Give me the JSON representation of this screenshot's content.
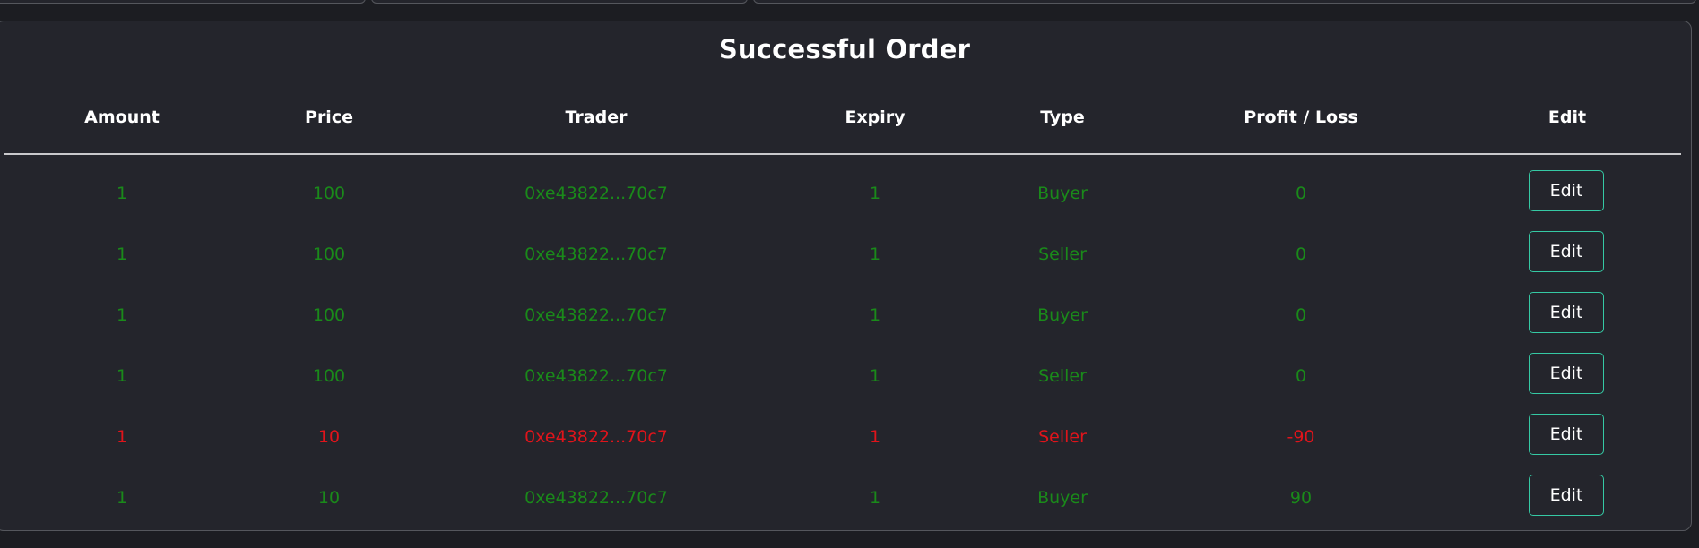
{
  "page": {
    "title": "Successful Order"
  },
  "colors": {
    "profit": "#1a8a1a",
    "loss": "#e0141b",
    "header_text": "#ffffff",
    "edit_border": "#35c9a4"
  },
  "table": {
    "headers": {
      "amount": "Amount",
      "price": "Price",
      "trader": "Trader",
      "expiry": "Expiry",
      "type": "Type",
      "profit_loss": "Profit / Loss",
      "edit": "Edit"
    },
    "rows": [
      {
        "amount": "1",
        "price": "100",
        "trader": "0xe43822...70c7",
        "expiry": "1",
        "type": "Buyer",
        "profit_loss": "0",
        "edit": "Edit",
        "status": "profit"
      },
      {
        "amount": "1",
        "price": "100",
        "trader": "0xe43822...70c7",
        "expiry": "1",
        "type": "Seller",
        "profit_loss": "0",
        "edit": "Edit",
        "status": "profit"
      },
      {
        "amount": "1",
        "price": "100",
        "trader": "0xe43822...70c7",
        "expiry": "1",
        "type": "Buyer",
        "profit_loss": "0",
        "edit": "Edit",
        "status": "profit"
      },
      {
        "amount": "1",
        "price": "100",
        "trader": "0xe43822...70c7",
        "expiry": "1",
        "type": "Seller",
        "profit_loss": "0",
        "edit": "Edit",
        "status": "profit"
      },
      {
        "amount": "1",
        "price": "10",
        "trader": "0xe43822...70c7",
        "expiry": "1",
        "type": "Seller",
        "profit_loss": "-90",
        "edit": "Edit",
        "status": "loss"
      },
      {
        "amount": "1",
        "price": "10",
        "trader": "0xe43822...70c7",
        "expiry": "1",
        "type": "Buyer",
        "profit_loss": "90",
        "edit": "Edit",
        "status": "profit"
      }
    ]
  }
}
